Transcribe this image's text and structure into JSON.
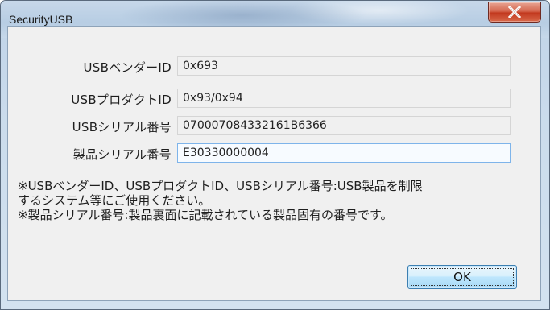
{
  "window": {
    "title": "SecurityUSB"
  },
  "fields": [
    {
      "label": "USBベンダーID",
      "value": "0x693"
    },
    {
      "label": "USBプロダクトID",
      "value": "0x93/0x94"
    },
    {
      "label": "USBシリアル番号",
      "value": "07000708433216‍1B6366"
    },
    {
      "label": "製品シリアル番号",
      "value": "E30330000004"
    }
  ],
  "notes": {
    "line1": "※USBベンダーID、USBプロダクトID、USBシリアル番号:USB製品を制限",
    "line2": "するシステム等にご使用ください。",
    "line3": "※製品シリアル番号:製品裏面に記載されている製品固有の番号です。"
  },
  "buttons": {
    "ok_label": "OK",
    "close_icon": "close-x"
  },
  "colors": {
    "close_button": "#c2381e",
    "ok_button_border": "#3c7fb1",
    "focused_field_border": "#7eb4ea"
  }
}
